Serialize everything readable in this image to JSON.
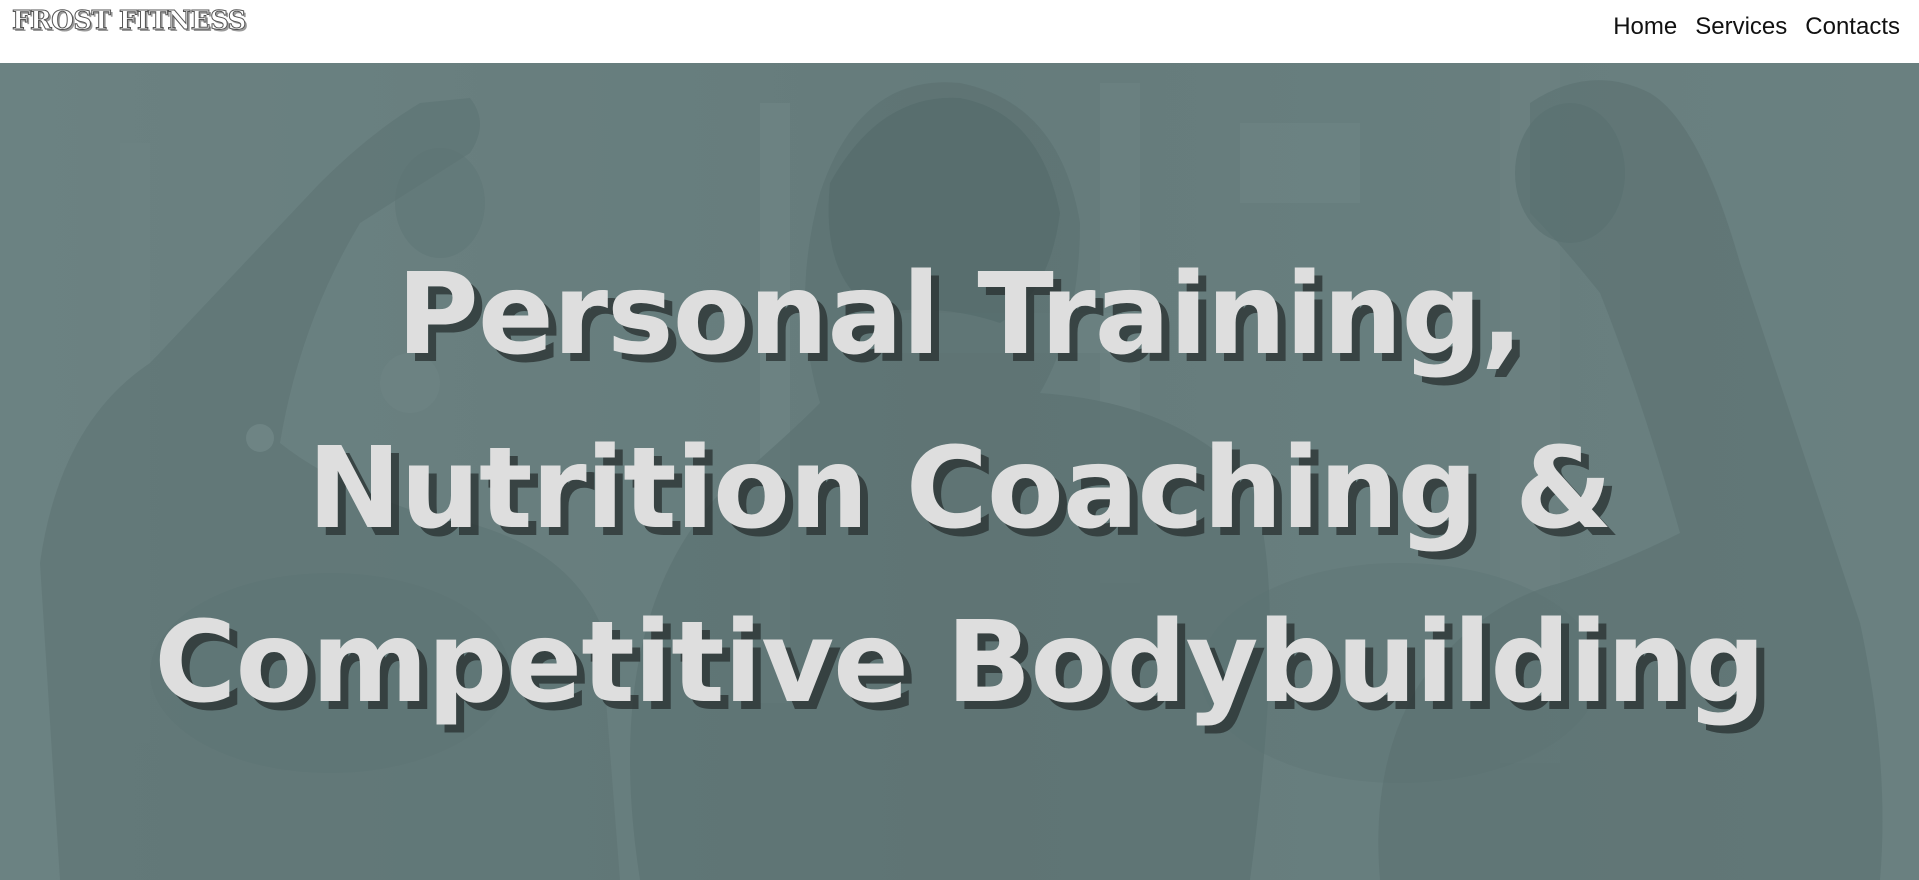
{
  "brand": {
    "logo_text": "FROST FITNESS"
  },
  "nav": {
    "items": [
      {
        "label": "Home"
      },
      {
        "label": "Services"
      },
      {
        "label": "Contacts"
      }
    ]
  },
  "hero": {
    "headline_lines": [
      "Personal Training,",
      "Nutrition Coaching &",
      "Competitive Bodybuilding"
    ],
    "text_color": "#dedede",
    "tint_color": "#6f8383"
  }
}
